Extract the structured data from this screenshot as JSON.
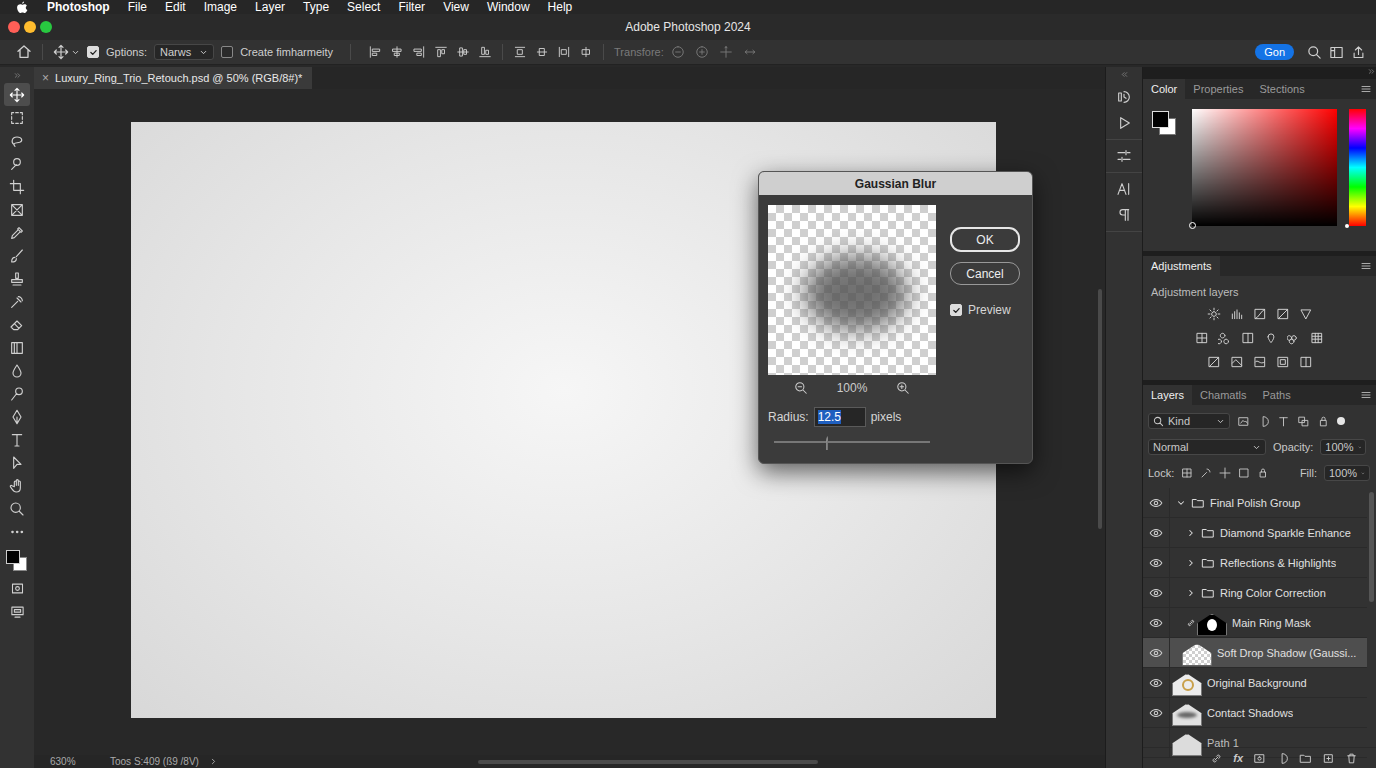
{
  "menubar": {
    "app": "Photoshop",
    "items": [
      "File",
      "Edit",
      "Image",
      "Layer",
      "Type",
      "Select",
      "Filter",
      "View",
      "Window",
      "Help"
    ]
  },
  "window": {
    "title": "Adobe Photoshop 2024"
  },
  "options_bar": {
    "auto_select": {
      "label": "Gptions:",
      "checked": true
    },
    "target": "Narws",
    "transform_controls": {
      "label": "Create fimharmeity",
      "checked": false
    },
    "transform": {
      "label": "Transfore:",
      "disabled": true
    },
    "button": "Gon"
  },
  "tools": [
    {
      "selected": true
    },
    {
      "selected": false
    },
    {
      "selected": false
    },
    {
      "selected": false
    },
    {
      "selected": false
    },
    {
      "selected": false
    },
    {
      "selected": false
    },
    {
      "selected": false
    },
    {
      "selected": false
    },
    {
      "selected": false
    },
    {
      "selected": false
    },
    {
      "selected": false
    },
    {
      "selected": false
    },
    {
      "selected": false
    },
    {
      "selected": false
    },
    {
      "selected": false
    },
    {
      "selected": false
    },
    {
      "selected": false
    },
    {
      "selected": false
    },
    {
      "selected": false
    }
  ],
  "document": {
    "tab": "Luxury_Ring_Trio_Retouch.psd @ 50% (RGB/8#)*",
    "close": "×"
  },
  "status_bar": {
    "zoom": "630%",
    "info": "Toos S:409 (ß9 /8V)"
  },
  "dialog": {
    "title": "Gaussian Blur",
    "zoom": "100%",
    "ok": "OK",
    "cancel": "Cancel",
    "preview": {
      "label": "Preview",
      "checked": true
    },
    "radius": {
      "label": "Radius:",
      "value": "12.5",
      "unit": "pixels",
      "level": 0.36
    }
  },
  "color_panel": {
    "tabs": [
      {
        "label": "Color",
        "selected": true
      },
      {
        "label": "Properties",
        "selected": false
      },
      {
        "label": "Stections",
        "selected": false
      }
    ]
  },
  "adjustments": {
    "title": "Adjustments",
    "subtitle": "Adjustment layers"
  },
  "layers_panel": {
    "tabs": [
      {
        "label": "Layers",
        "selected": true
      },
      {
        "label": "Chamatls",
        "selected": false
      },
      {
        "label": "Paths",
        "selected": false
      }
    ],
    "filter": "Kind",
    "blend_mode": "Normal",
    "opacity": {
      "label": "Opacity:",
      "value": "100%"
    },
    "lock_label": "Lock:",
    "fill": {
      "label": "Fill:",
      "value": "100%"
    },
    "footer_fx": "fx",
    "layers": [
      {
        "name": "Final Polish Group",
        "kind": "group",
        "expanded": true,
        "visible": true,
        "in_group": false,
        "selected": false
      },
      {
        "name": "Diamond Sparkle Enhance",
        "kind": "group",
        "expanded": false,
        "visible": true,
        "in_group": true,
        "selected": false
      },
      {
        "name": "Reflections & Highlights",
        "kind": "group",
        "expanded": false,
        "visible": true,
        "in_group": true,
        "selected": false
      },
      {
        "name": "Ring Color Correction",
        "kind": "group",
        "expanded": false,
        "visible": true,
        "in_group": true,
        "selected": false
      },
      {
        "name": "Main Ring Mask",
        "kind": "mask",
        "visible": true,
        "in_group": true,
        "selected": false
      },
      {
        "name": "Soft Drop Shadow (Gaussi...",
        "kind": "transparent",
        "visible": true,
        "in_group": true,
        "selected": true
      },
      {
        "name": "Original Background",
        "kind": "photo",
        "visible": true,
        "in_group": false,
        "selected": false
      },
      {
        "name": "Contact Shadows",
        "kind": "shadow",
        "visible": true,
        "in_group": false,
        "selected": false
      },
      {
        "name": "Path 1",
        "kind": "path",
        "visible": false,
        "in_group": false,
        "selected": false
      }
    ]
  }
}
